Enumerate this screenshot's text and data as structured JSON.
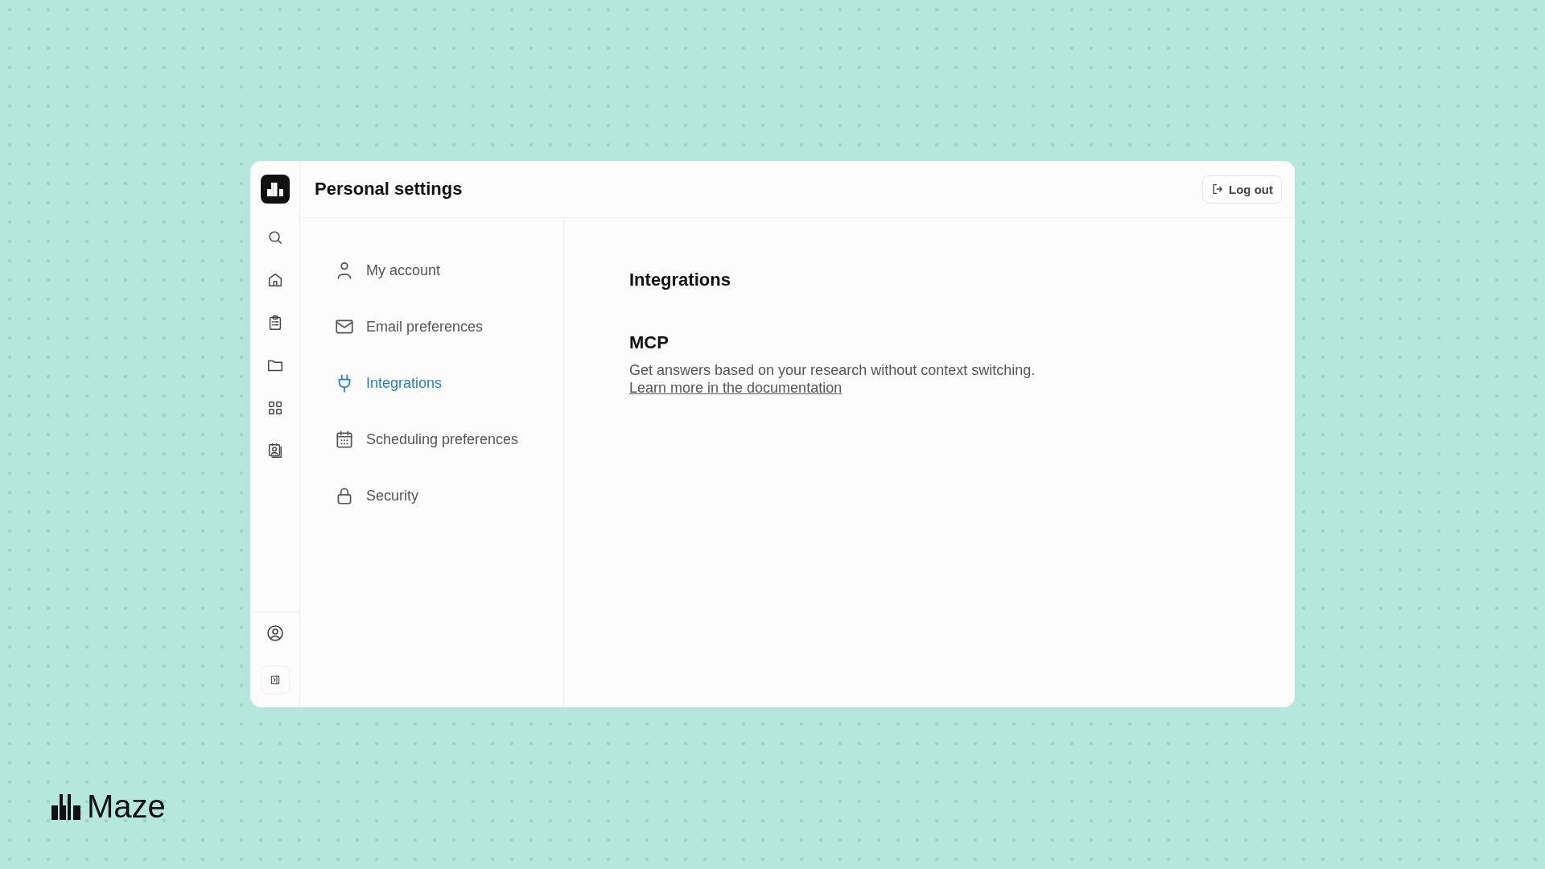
{
  "header": {
    "title": "Personal settings",
    "logout": "Log out"
  },
  "rail": {
    "items": [
      {
        "kind": "search"
      },
      {
        "kind": "home"
      },
      {
        "kind": "clipboard"
      },
      {
        "kind": "folder"
      },
      {
        "kind": "grid"
      },
      {
        "kind": "contacts"
      }
    ],
    "bottom": [
      {
        "kind": "profile"
      },
      {
        "kind": "collapse"
      }
    ]
  },
  "nav": [
    {
      "label": "My account",
      "kind": "person",
      "selected": false
    },
    {
      "label": "Email preferences",
      "kind": "mail",
      "selected": false
    },
    {
      "label": "Integrations",
      "kind": "plug",
      "selected": true
    },
    {
      "label": "Scheduling preferences",
      "kind": "calendar",
      "selected": false
    },
    {
      "label": "Security",
      "kind": "lock",
      "selected": false
    }
  ],
  "content": {
    "title": "Integrations",
    "section": {
      "title": "MCP",
      "description": "Get answers based on your research without context switching.",
      "link": "Learn more in the documentation"
    }
  },
  "brand": {
    "name": "Maze"
  }
}
